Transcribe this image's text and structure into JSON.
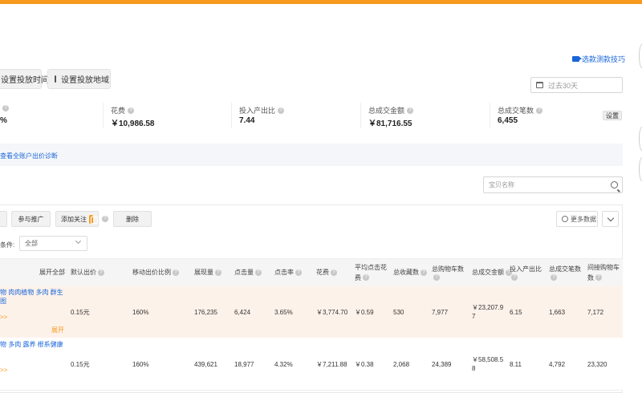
{
  "video_tip": "选款测款技巧",
  "buttons": {
    "set_time": "设置投放时间",
    "set_region": "设置投放地域"
  },
  "date_range": "过去30天",
  "metrics": [
    {
      "label": "",
      "value": "%"
    },
    {
      "label": "花费",
      "value": "￥10,986.58"
    },
    {
      "label": "投入产出比",
      "value": "7.44"
    },
    {
      "label": "总成交金额",
      "value": "￥81,716.55"
    },
    {
      "label": "总成交笔数",
      "value": "6,455"
    }
  ],
  "metrics_setting": "设置",
  "diagnosis_link": "查看全账户出价诊断",
  "search_placeholder": "宝贝名称",
  "toolbar": {
    "join_promo": "参与推广",
    "add_follow": "添加关注",
    "delete": "删除",
    "more_data": "更多数据"
  },
  "filter": {
    "label": "条件:",
    "value": "全部"
  },
  "columns": {
    "expand_all": "展开全部",
    "default_bid": "默认出价",
    "mobile_ratio": "移动出价比例",
    "impressions": "展现量",
    "clicks": "点击量",
    "ctr": "点击率",
    "cost": "花费",
    "avg_cpc_a": "平均点击花",
    "avg_cpc_b": "费",
    "favorites": "总收藏数",
    "cart": "总购物车数",
    "gmv": "总成交金额",
    "roi": "投入产出比",
    "orders": "总成交笔数",
    "indirect_cart_a": "间接购物车",
    "indirect_cart_b": "数"
  },
  "rows": [
    {
      "tags_line1": "物 肉肉植物 多肉 群生",
      "tags_line2": "图",
      "more": ">>",
      "expand": "展开",
      "default_bid": "0.15元",
      "mobile_ratio": "160%",
      "impressions": "176,235",
      "clicks": "6,424",
      "ctr": "3.65%",
      "cost": "￥3,774.70",
      "avg_cpc": "￥0.59",
      "favorites": "530",
      "cart": "7,977",
      "gmv_a": "￥23,207.9",
      "gmv_b": "7",
      "roi": "6.15",
      "orders": "1,663",
      "indirect_cart": "7,172"
    },
    {
      "tags_line1": "物 多肉 露养 根系健康",
      "tags_line2": "",
      "more": ">>",
      "expand": "",
      "default_bid": "0.15元",
      "mobile_ratio": "160%",
      "impressions": "439,621",
      "clicks": "18,977",
      "ctr": "4.32%",
      "cost": "￥7,211.88",
      "avg_cpc": "￥0.38",
      "favorites": "2,068",
      "cart": "24,389",
      "gmv_a": "￥58,508.5",
      "gmv_b": "8",
      "roi": "8.11",
      "orders": "4,792",
      "indirect_cart": "23,320"
    }
  ]
}
